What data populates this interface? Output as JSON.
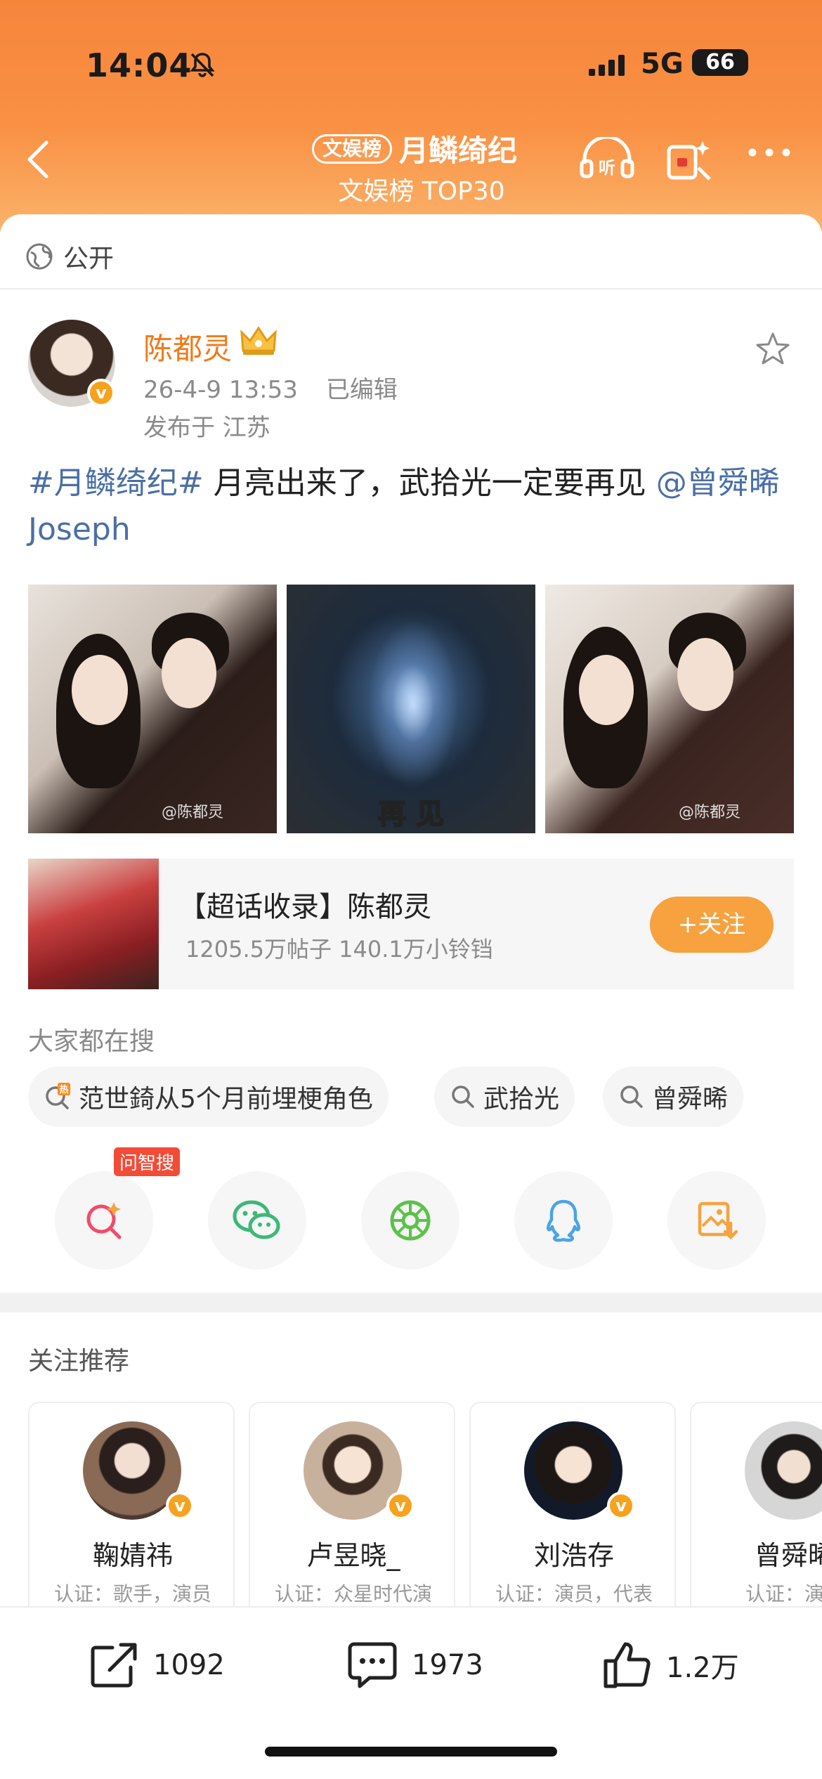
{
  "status_bar": {
    "time": "14:04",
    "network": "5G",
    "battery": "66",
    "battery_level": 0.66
  },
  "nav": {
    "tag": "文娱榜",
    "title": "月鳞绮纪",
    "subtitle": "文娱榜 TOP30"
  },
  "visibility": "公开",
  "post": {
    "author": "陈都灵",
    "date": "26-4-9 13:53",
    "edited": "已编辑",
    "location": "发布于 江苏",
    "hashtag": "#月鳞绮纪#",
    "text": " 月亮出来了，武拾光一定要再见 ",
    "mention": "@曾舜晞 Joseph",
    "photos": [
      {
        "watermark": "@陈都灵"
      },
      {
        "caption": "再 见"
      },
      {
        "watermark": "@陈都灵"
      }
    ]
  },
  "supertopic": {
    "title": "【超话收录】陈都灵",
    "stats": "1205.5万帖子 140.1万小铃铛",
    "follow_label": "+关注"
  },
  "search": {
    "label": "大家都在搜",
    "chips": [
      {
        "text": "范世錡从5个月前埋梗角色",
        "icon": "hot-search-icon"
      },
      {
        "text": "武拾光",
        "icon": "search-icon"
      },
      {
        "text": "曾舜晞",
        "icon": "search-icon"
      }
    ]
  },
  "share": {
    "badge": "问智搜",
    "icons": [
      "ai-search-icon",
      "wechat-icon",
      "moments-icon",
      "qq-icon",
      "save-image-icon"
    ]
  },
  "recommend": {
    "label": "关注推荐",
    "users": [
      {
        "name": "鞠婧祎",
        "desc": "认证：歌手，演员"
      },
      {
        "name": "卢昱晓_",
        "desc": "认证：众星时代演"
      },
      {
        "name": "刘浩存",
        "desc": "认证：演员，代表"
      },
      {
        "name": "曾舜晞",
        "desc": "认证：演员"
      }
    ]
  },
  "actions": {
    "reposts": "1092",
    "comments": "1973",
    "likes": "1.2万"
  },
  "colors": {
    "accent": "#f7a23e",
    "header": "#f6853a",
    "link": "#4a6fa5",
    "username": "#f07a1a"
  }
}
